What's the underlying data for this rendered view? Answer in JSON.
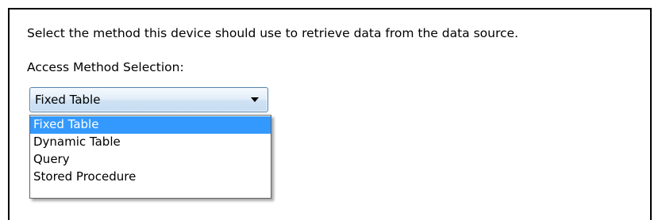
{
  "dialog": {
    "instruction": "Select the method this device should use to retrieve data from the data source.",
    "access_method_label": "Access Method Selection:"
  },
  "access_method": {
    "selected_value": "Fixed Table",
    "options": [
      {
        "label": "Fixed Table",
        "highlighted": true
      },
      {
        "label": "Dynamic Table",
        "highlighted": false
      },
      {
        "label": "Query",
        "highlighted": false
      },
      {
        "label": "Stored Procedure",
        "highlighted": false
      }
    ],
    "highlight_color": "#3399ff"
  }
}
